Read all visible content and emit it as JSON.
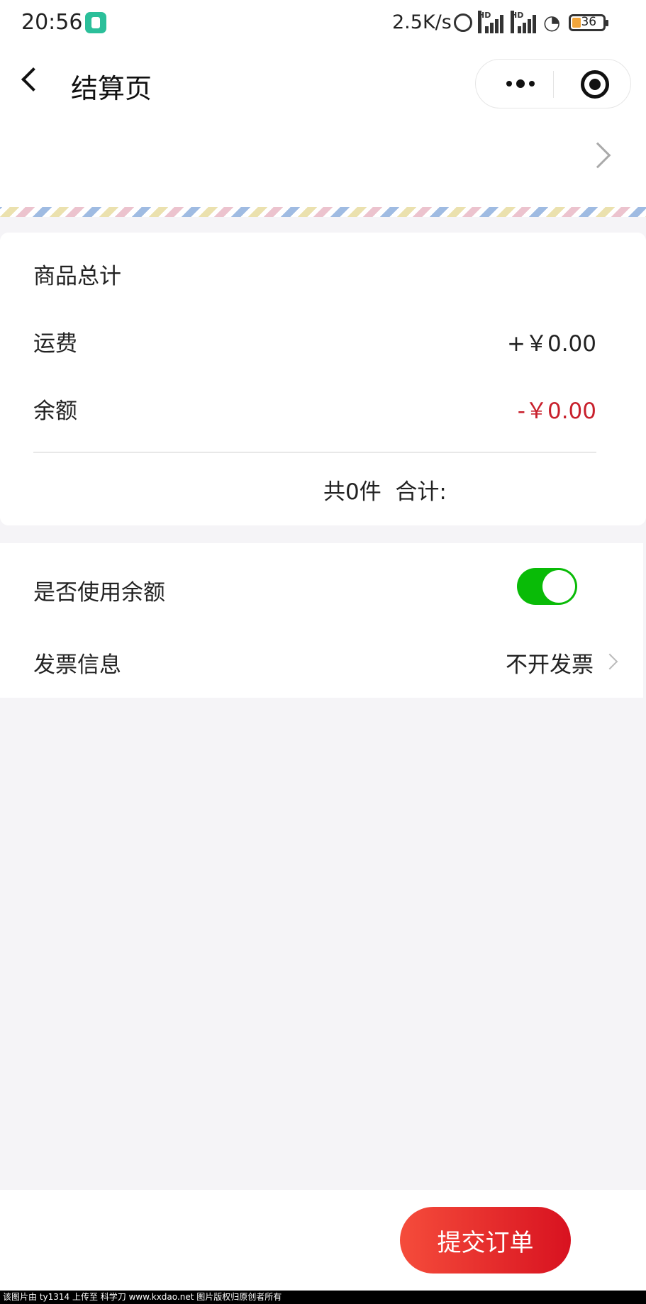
{
  "status_bar": {
    "time": "20:56",
    "net_speed": "2.5K/s",
    "hd1": "HD",
    "hd2": "HD",
    "battery": "36",
    "icons": [
      "app-shield-icon",
      "alarm-icon",
      "signal-icon",
      "signal-icon",
      "wifi-icon",
      "battery-icon"
    ]
  },
  "nav": {
    "title": "结算页"
  },
  "summary": {
    "goods_total_label": "商品总计",
    "shipping_label": "运费",
    "shipping_value": "+￥0.00",
    "balance_label": "余额",
    "balance_value": "-￥0.00",
    "total_text": "共0件  合计:"
  },
  "options": {
    "use_balance_label": "是否使用余额",
    "use_balance_on": true,
    "invoice_label": "发票信息",
    "invoice_value": "不开发票"
  },
  "bottom": {
    "submit_label": "提交订单"
  },
  "colors": {
    "toggle_on": "#09bb07",
    "accent_red": "#c8202c",
    "button_gradient_start": "#f54c3b",
    "button_gradient_end": "#d81220"
  },
  "watermark": "该图片由 ty1314 上传至 科学刀 www.kxdao.net 图片版权归原创者所有"
}
